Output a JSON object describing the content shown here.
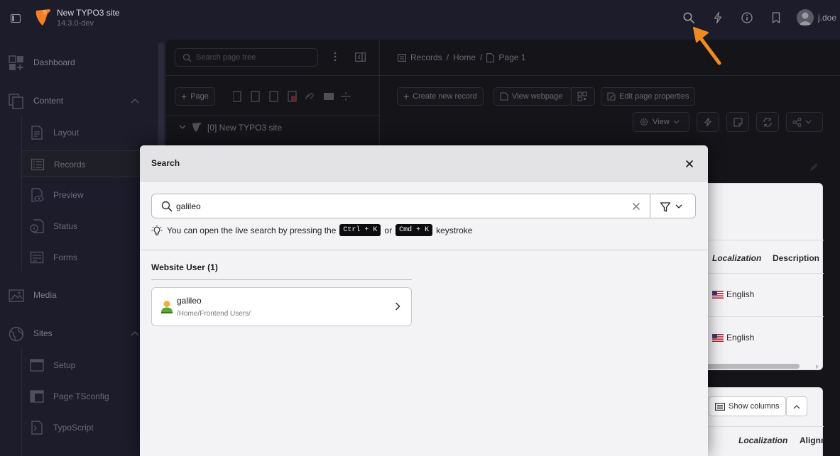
{
  "topbar": {
    "site_name": "New TYPO3 site",
    "version": "14.3.0-dev",
    "username": "j.doe",
    "icons": [
      "search-icon",
      "flash-icon",
      "info-icon",
      "bookmark-icon"
    ]
  },
  "modules": {
    "dashboard": "Dashboard",
    "content": "Content",
    "content_items": [
      "Layout",
      "Records",
      "Preview",
      "Status",
      "Forms"
    ],
    "media": "Media",
    "sites": "Sites",
    "sites_items": [
      "Setup",
      "Page TSconfig",
      "TypoScript"
    ]
  },
  "page_tree": {
    "search_placeholder": "Search page tree",
    "new_page_label": "Page",
    "root_node": "[0] New TYPO3 site"
  },
  "breadcrumb": [
    "Records",
    "Home",
    "Page 1"
  ],
  "toolbar": {
    "create_record": "Create new record",
    "view_webpage": "View webpage",
    "edit_page_properties": "Edit page properties",
    "view": "View"
  },
  "modal": {
    "title": "Search",
    "query": "galileo",
    "hint_prefix": "You can open the live search by pressing the",
    "shortcut_1": "Ctrl + K",
    "hint_or": "or",
    "shortcut_2": "Cmd + K",
    "hint_suffix": "keystroke",
    "groups": [
      {
        "title": "Website User (1)",
        "results": [
          {
            "title": "galileo",
            "path": "/Home/Frontend Users/"
          }
        ]
      }
    ]
  },
  "records_table": {
    "headers": [
      "Localization",
      "Description"
    ],
    "rows": [
      {
        "language": "English"
      },
      {
        "language": "English"
      }
    ],
    "show_columns": "Show columns",
    "headers_2": [
      "Localization",
      "Alignr"
    ]
  },
  "colors": {
    "accent_arrow": "#f08a24",
    "topbar_bg": "#1c1c2a",
    "modal_bg": "#f3f3f5"
  }
}
